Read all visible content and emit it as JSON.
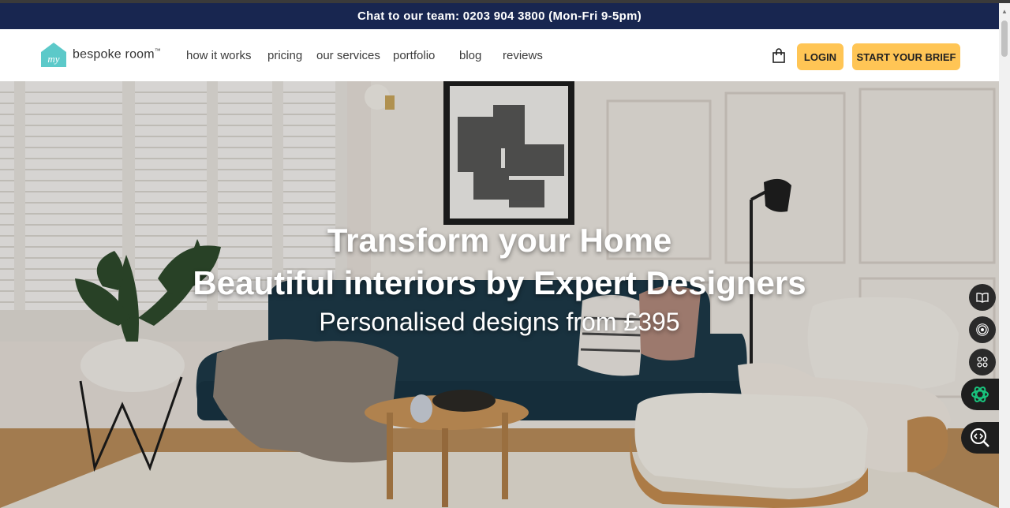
{
  "announcement": "Chat to our team: 0203 904 3800 (Mon-Fri 9-5pm)",
  "logo": {
    "mark_text": "my",
    "brand": "bespoke room",
    "tm": "™"
  },
  "nav": [
    {
      "label": "how it works"
    },
    {
      "label": "pricing"
    },
    {
      "label": "our services"
    },
    {
      "label": "portfolio"
    },
    {
      "label": "blog"
    },
    {
      "label": "reviews"
    }
  ],
  "header_actions": {
    "login": "LOGIN",
    "start_brief": "START YOUR BRIEF"
  },
  "hero": {
    "line1": "Transform your Home",
    "line2": "Beautiful interiors by Expert Designers",
    "line3": "Personalised designs from £395"
  },
  "colors": {
    "announce_bg": "#182650",
    "accent": "#ffc555",
    "logo_teal": "#5cc9c9"
  },
  "side_tools": [
    "book-icon",
    "broadcast-icon",
    "grid-icon",
    "ai-assistant-icon",
    "code-search-icon"
  ]
}
